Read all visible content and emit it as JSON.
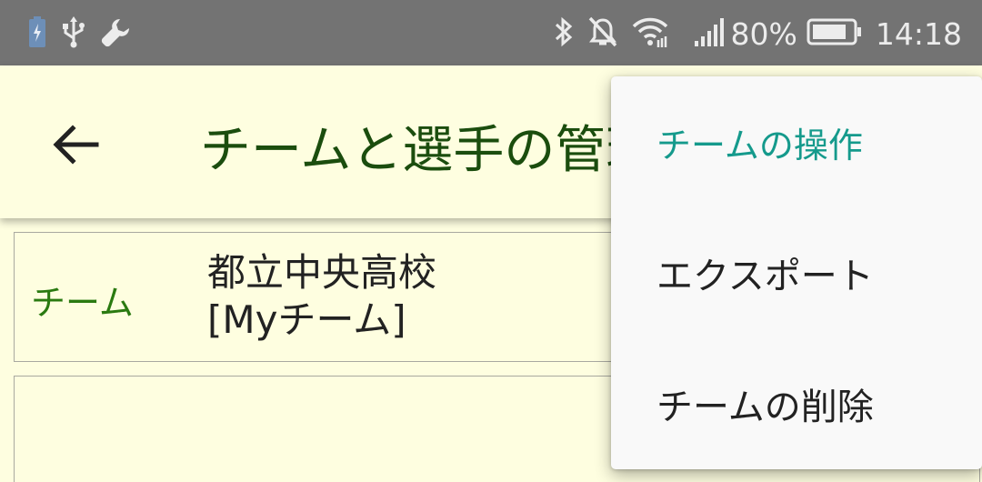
{
  "status_bar": {
    "icons_left": [
      "battery-saver-icon",
      "usb-icon",
      "wrench-icon"
    ],
    "icons_right": [
      "bluetooth-icon",
      "mute-icon",
      "wifi-icon",
      "signal-icon",
      "battery-icon"
    ],
    "battery_percent": "80%",
    "time": "14:18",
    "text_color": "#ececec",
    "background": "#737373"
  },
  "app_bar": {
    "back_icon": "arrow-left-icon",
    "title": "チームと選手の管理",
    "title_color": "#1b4d0e",
    "background": "#fefee0"
  },
  "team": {
    "label": "チーム",
    "name_line1": "都立中央高校",
    "name_line2": "[Myチーム]"
  },
  "menu": {
    "header": "チームの操作",
    "items": [
      {
        "label": "エクスポート"
      },
      {
        "label": "チームの削除"
      }
    ],
    "header_color": "#159a8c"
  }
}
